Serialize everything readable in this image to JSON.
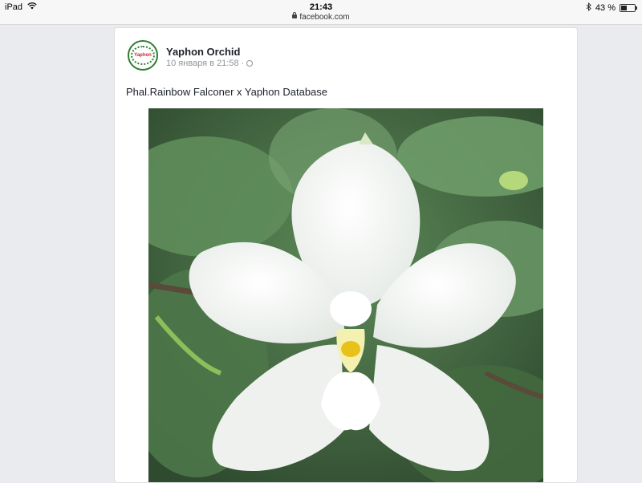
{
  "status_bar": {
    "device": "iPad",
    "time": "21:43",
    "url": "facebook.com",
    "battery_text": "43 %",
    "battery_level": 0.43
  },
  "post": {
    "page_name": "Yaphon Orchid",
    "date": "10 января в 21:58",
    "separator": "·",
    "text": "Phal.Rainbow Falconer x Yaphon Database",
    "avatar_text": "Yaphon"
  },
  "colors": {
    "link": "#1d2129",
    "background": "#e9ebee",
    "leaf": "#4f7a4c",
    "flower": "#f4f6f4"
  }
}
